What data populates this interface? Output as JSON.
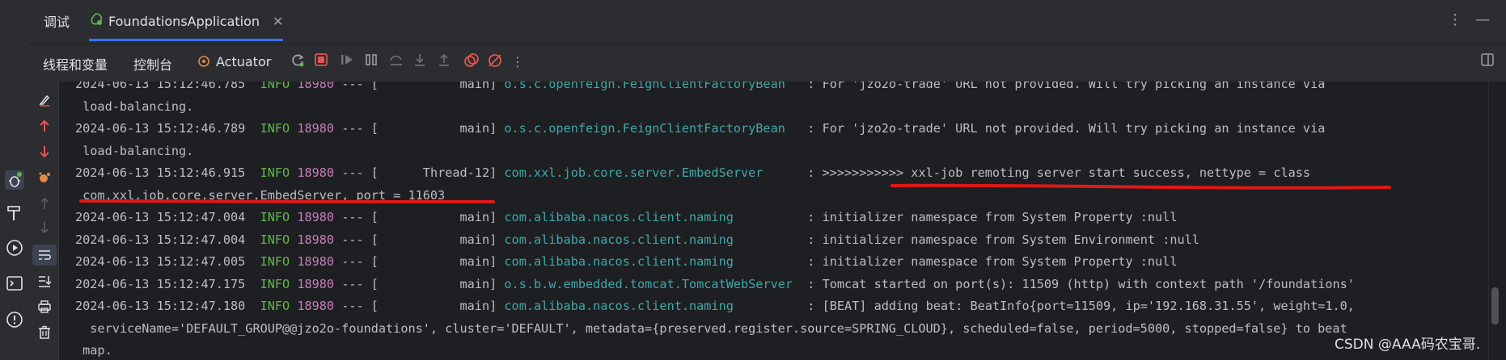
{
  "tabs": {
    "debug_label": "调试",
    "app_label": "FoundationsApplication",
    "close_glyph": "✕",
    "more_glyph": "⋮",
    "minimize_glyph": "—"
  },
  "toolbar": {
    "threads_label": "线程和变量",
    "console_label": "控制台",
    "actuator_label": "Actuator",
    "more_glyph": "⋮"
  },
  "console": {
    "lines": [
      {
        "ts": "2024-06-13 15:12:46.785",
        "lvl": "INFO",
        "pid": "18980",
        "sep": " --- [",
        "thread": "           main]",
        "logger": "o.s.c.openfeign.FeignClientFactoryBean",
        "msg": "   : For 'jzo2o-trade' URL not provided. Will try picking an instance via"
      },
      {
        "cont": " load-balancing."
      },
      {
        "ts": "2024-06-13 15:12:46.789",
        "lvl": "INFO",
        "pid": "18980",
        "sep": " --- [",
        "thread": "           main]",
        "logger": "o.s.c.openfeign.FeignClientFactoryBean",
        "msg": "   : For 'jzo2o-trade' URL not provided. Will try picking an instance via"
      },
      {
        "cont": " load-balancing."
      },
      {
        "ts": "2024-06-13 15:12:46.915",
        "lvl": "INFO",
        "pid": "18980",
        "sep": " --- [",
        "thread": "      Thread-12]",
        "logger": "com.xxl.job.core.server.EmbedServer",
        "msg": "      : >>>>>>>>>>> xxl-job remoting server start success, nettype = class"
      },
      {
        "cont": " com.xxl.job.core.server.EmbedServer, port = 11603"
      },
      {
        "ts": "2024-06-13 15:12:47.004",
        "lvl": "INFO",
        "pid": "18980",
        "sep": " --- [",
        "thread": "           main]",
        "logger": "com.alibaba.nacos.client.naming",
        "msg": "          : initializer namespace from System Property :null"
      },
      {
        "ts": "2024-06-13 15:12:47.004",
        "lvl": "INFO",
        "pid": "18980",
        "sep": " --- [",
        "thread": "           main]",
        "logger": "com.alibaba.nacos.client.naming",
        "msg": "          : initializer namespace from System Environment :null"
      },
      {
        "ts": "2024-06-13 15:12:47.005",
        "lvl": "INFO",
        "pid": "18980",
        "sep": " --- [",
        "thread": "           main]",
        "logger": "com.alibaba.nacos.client.naming",
        "msg": "          : initializer namespace from System Property :null"
      },
      {
        "ts": "2024-06-13 15:12:47.175",
        "lvl": "INFO",
        "pid": "18980",
        "sep": " --- [",
        "thread": "           main]",
        "logger": "o.s.b.w.embedded.tomcat.TomcatWebServer",
        "msg": "  : Tomcat started on port(s): 11509 (http) with context path '/foundations'"
      },
      {
        "ts": "2024-06-13 15:12:47.180",
        "lvl": "INFO",
        "pid": "18980",
        "sep": " --- [",
        "thread": "           main]",
        "logger": "com.alibaba.nacos.client.naming",
        "msg": "          : [BEAT] adding beat: BeatInfo{port=11509, ip='192.168.31.55', weight=1.0,"
      },
      {
        "cont": "  serviceName='DEFAULT_GROUP@@jzo2o-foundations', cluster='DEFAULT', metadata={preserved.register.source=SPRING_CLOUD}, scheduled=false, period=5000, stopped=false} to beat"
      },
      {
        "cont": " map."
      }
    ]
  },
  "watermark": "CSDN @AAA码农宝哥.",
  "colors": {
    "info": "#5fb84c",
    "pid": "#c77dbb",
    "logger": "#3fa8a8",
    "annotation": "#e01818",
    "accent": "#3574f0"
  }
}
